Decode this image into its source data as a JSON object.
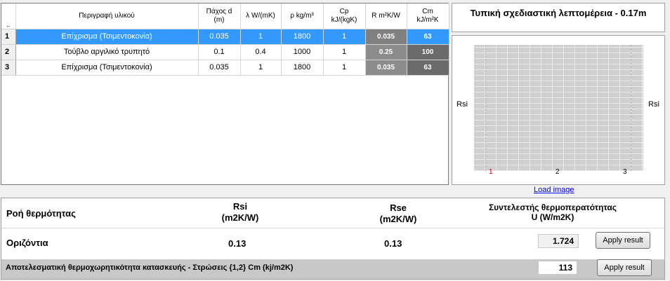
{
  "grid": {
    "columns": {
      "rowheader": "..",
      "description": "Περιγραφή υλικού",
      "thickness": [
        "Πάχος d",
        "(m)"
      ],
      "lambda": "λ W/(mK)",
      "rho": "ρ kg/m³",
      "cp": [
        "Cp",
        "kJ/(kgK)"
      ],
      "r": "R m²K/W",
      "cm": [
        "Cm",
        "kJ/m²K"
      ]
    },
    "rows": [
      {
        "num": "1",
        "description": "Επίχρισμα (Τσιμεντοκονία)",
        "thickness": "0.035",
        "lambda": "1",
        "rho": "1800",
        "cp": "1",
        "r": "0.035",
        "cm": "63"
      },
      {
        "num": "2",
        "description": "Τούβλο αργιλικό τρυπητό",
        "thickness": "0.1",
        "lambda": "0.4",
        "rho": "1000",
        "cp": "1",
        "r": "0.25",
        "cm": "100"
      },
      {
        "num": "3",
        "description": "Επίχρισμα (Τσιμεντοκονία)",
        "thickness": "0.035",
        "lambda": "1",
        "rho": "1800",
        "cp": "1",
        "r": "0.035",
        "cm": "63"
      }
    ]
  },
  "detail": {
    "title": "Τυπική σχεδιαστική λεπτομέρεια - 0.17m",
    "rsi_left": "Rsi",
    "rsi_right": "Rsi",
    "layer_numbers": [
      "1",
      "2",
      "3"
    ],
    "load_image": "Load image",
    "colors": {
      "layer_1": "#cc0000",
      "layer_other": "#000000"
    }
  },
  "bottom": {
    "flow_label": "Ροή θερμότητας",
    "rsi_header": [
      "Rsi",
      "(m2K/W)"
    ],
    "rse_header": [
      "Rse",
      "(m2K/W)"
    ],
    "u_header": [
      "Συντελεστής θερμοπερατότητας",
      "U (W/m2K)"
    ],
    "orientation": "Οριζόντια",
    "rsi_value": "0.13",
    "rse_value": "0.13",
    "u_value": "1.724",
    "apply_label": "Apply result",
    "cm_label": "Αποτελεσματική θερμοχωρητικότητα κατασκευής - Στρώσεις {1,2} Cm (kj/m2K)",
    "cm_value": "113",
    "apply_label_2": "Apply result"
  }
}
